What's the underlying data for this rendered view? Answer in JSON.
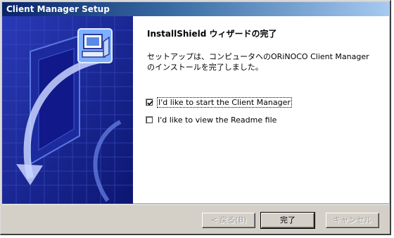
{
  "window": {
    "title": "Client Manager Setup"
  },
  "wizard": {
    "heading": "InstallShield ウィザードの完了",
    "body": "セットアップは、コンピュータへのORiNOCO Client Managerのインストールを完了しました。",
    "options": [
      {
        "label": "I'd like to start the Client Manager",
        "checked": true
      },
      {
        "label": "I'd like to view the Readme file",
        "checked": false
      }
    ]
  },
  "buttons": {
    "back": "< 戻る(B)",
    "finish": "完了",
    "cancel": "キャンセル"
  },
  "icons": [
    "installshield-computer-icon",
    "checkmark-icon"
  ],
  "colors": {
    "titlebar_start": "#0a246a",
    "panel_blue": "#1a2a9a",
    "dialog_face": "#d4d0c8"
  }
}
